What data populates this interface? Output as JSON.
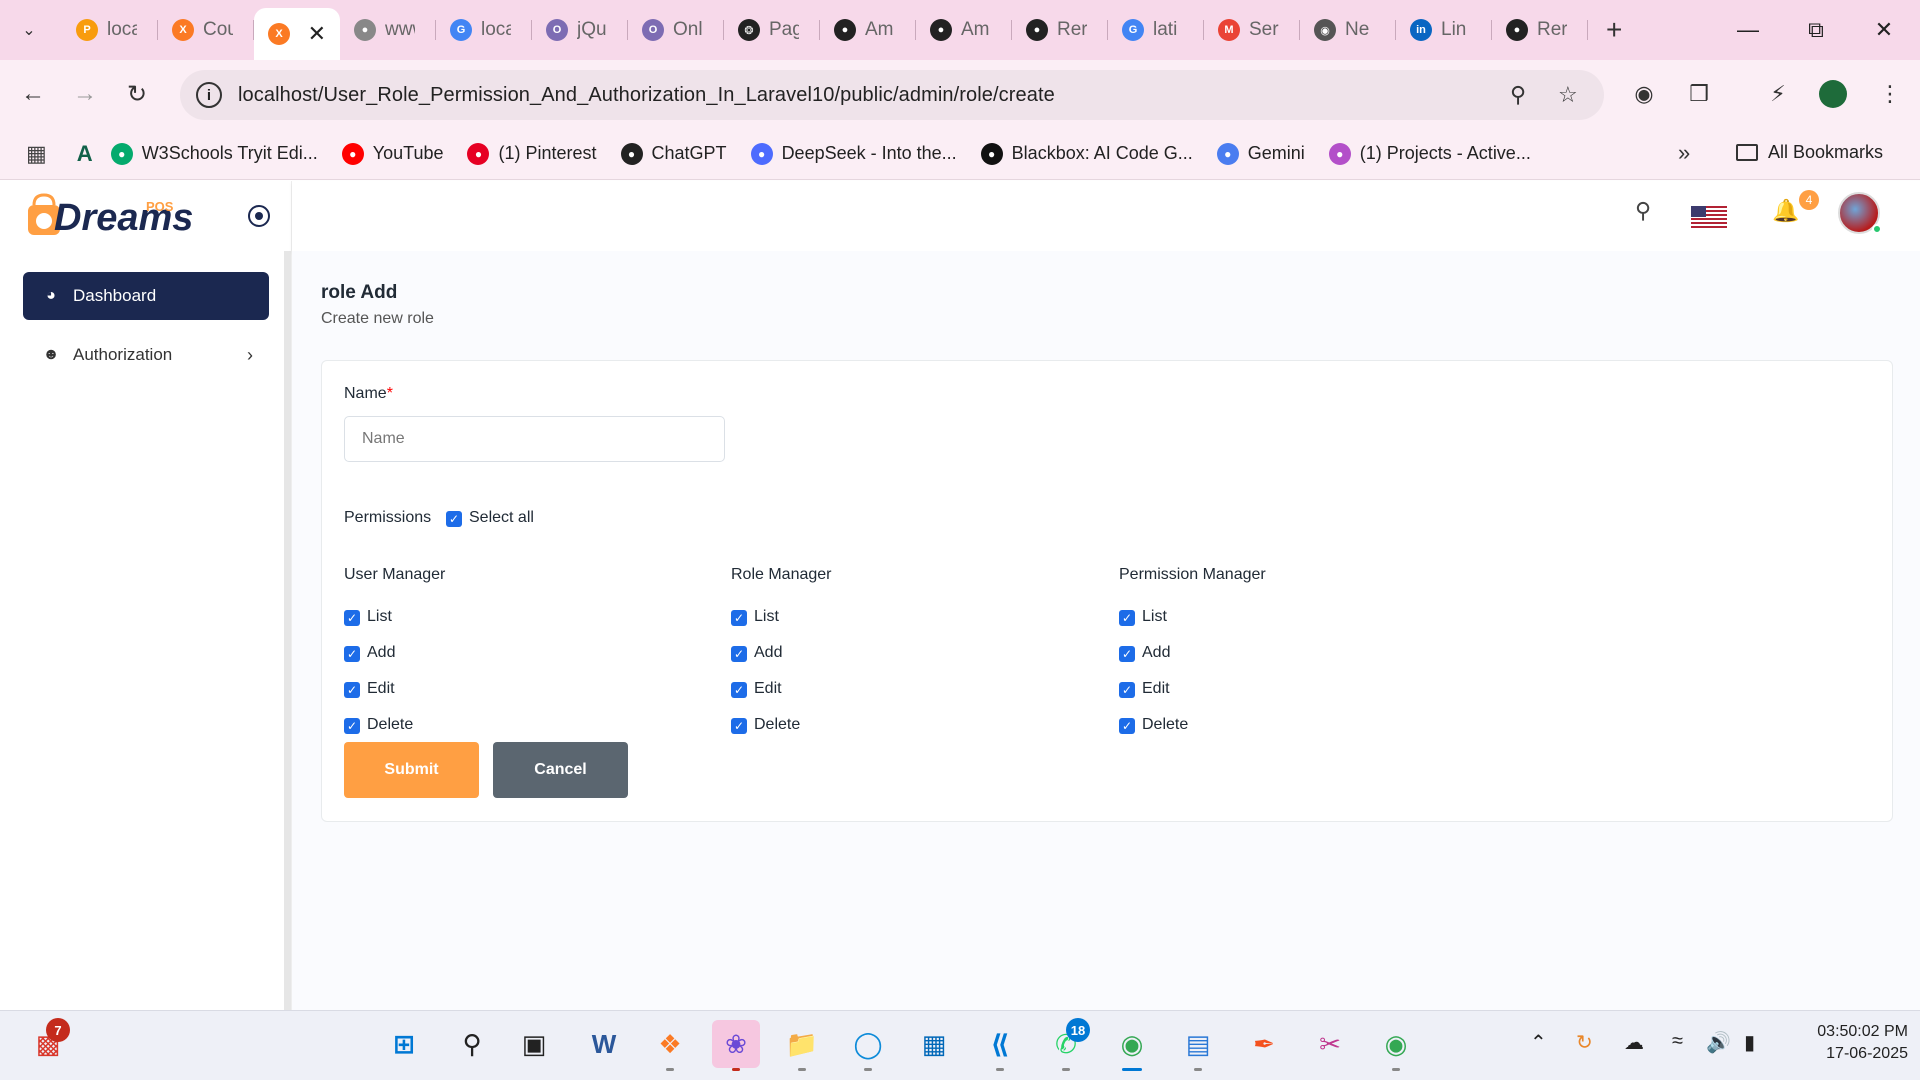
{
  "browser": {
    "tabs": [
      {
        "title": "loca",
        "icon": "phpmyadmin-icon",
        "color": "#f89c0e",
        "active": false
      },
      {
        "title": "Cou",
        "icon": "xampp-icon",
        "color": "#fb7a24",
        "active": false
      },
      {
        "title": "",
        "icon": "xampp-icon",
        "color": "#fb7a24",
        "active": true
      },
      {
        "title": "www",
        "icon": "globe-icon",
        "color": "#888888",
        "active": false
      },
      {
        "title": "loca",
        "icon": "google-icon",
        "color": "#4285f4",
        "active": false
      },
      {
        "title": "jQu",
        "icon": "owl-icon",
        "color": "#7d6cb3",
        "active": false
      },
      {
        "title": "Onl",
        "icon": "owl-icon",
        "color": "#7d6cb3",
        "active": false
      },
      {
        "title": "Pag",
        "icon": "chatgpt-icon",
        "color": "#222222",
        "active": false
      },
      {
        "title": "Am",
        "icon": "github-icon",
        "color": "#222222",
        "active": false
      },
      {
        "title": "Am",
        "icon": "github-icon",
        "color": "#222222",
        "active": false
      },
      {
        "title": "Rer",
        "icon": "github-icon",
        "color": "#222222",
        "active": false
      },
      {
        "title": "lati",
        "icon": "google-icon",
        "color": "#4285f4",
        "active": false
      },
      {
        "title": "Ser",
        "icon": "gmail-icon",
        "color": "#ea4335",
        "active": false
      },
      {
        "title": "Ne",
        "icon": "chrome-icon",
        "color": "#555555",
        "active": false
      },
      {
        "title": "Lin",
        "icon": "linkedin-icon",
        "color": "#0a66c2",
        "active": false
      },
      {
        "title": "Rer",
        "icon": "github-icon",
        "color": "#222222",
        "active": false
      }
    ],
    "url": "localhost/User_Role_Permission_And_Authorization_In_Laravel10/public/admin/role/create",
    "bookmarks": [
      {
        "label": "",
        "icon": "apps-grid-icon"
      },
      {
        "label": "",
        "icon": "a-logo-icon"
      },
      {
        "label": "W3Schools Tryit Edi...",
        "icon": "w3schools-icon",
        "color": "#04aa6d"
      },
      {
        "label": "YouTube",
        "icon": "youtube-icon",
        "color": "#ff0000"
      },
      {
        "label": "(1) Pinterest",
        "icon": "pinterest-icon",
        "color": "#e60023"
      },
      {
        "label": "ChatGPT",
        "icon": "chatgpt-icon",
        "color": "#222222"
      },
      {
        "label": "DeepSeek - Into the...",
        "icon": "deepseek-icon",
        "color": "#4d6bfe"
      },
      {
        "label": "Blackbox: AI Code G...",
        "icon": "blackbox-icon",
        "color": "#111111"
      },
      {
        "label": "Gemini",
        "icon": "gemini-icon",
        "color": "#4a7df0"
      },
      {
        "label": "(1) Projects - Active...",
        "icon": "projects-icon",
        "color": "#b34fc9"
      }
    ],
    "all_bookmarks": "All Bookmarks"
  },
  "app": {
    "logo_text": "Dreams",
    "logo_sup": "POS",
    "menu": [
      {
        "label": "Dashboard",
        "icon": "dashboard-icon",
        "active": true
      },
      {
        "label": "Authorization",
        "icon": "user-icon",
        "active": false
      }
    ],
    "notification_count": "4",
    "accent": "#ff9f43",
    "primary": "#1b2850"
  },
  "page": {
    "title": "role Add",
    "subtitle": "Create new role",
    "name_label": "Name",
    "name_required": "*",
    "name_placeholder": "Name",
    "name_value": "",
    "permissions_label": "Permissions",
    "select_all_label": "Select all",
    "select_all_checked": true,
    "groups": [
      {
        "title": "User Manager",
        "items": [
          {
            "label": "List",
            "checked": true
          },
          {
            "label": "Add",
            "checked": true
          },
          {
            "label": "Edit",
            "checked": true
          },
          {
            "label": "Delete",
            "checked": true
          }
        ]
      },
      {
        "title": "Role Manager",
        "items": [
          {
            "label": "List",
            "checked": true
          },
          {
            "label": "Add",
            "checked": true
          },
          {
            "label": "Edit",
            "checked": true
          },
          {
            "label": "Delete",
            "checked": true
          }
        ]
      },
      {
        "title": "Permission Manager",
        "items": [
          {
            "label": "List",
            "checked": true
          },
          {
            "label": "Add",
            "checked": true
          },
          {
            "label": "Edit",
            "checked": true
          },
          {
            "label": "Delete",
            "checked": true
          }
        ]
      }
    ],
    "submit_label": "Submit",
    "cancel_label": "Cancel",
    "submit_color": "#ff9f43",
    "cancel_color": "#5b6670"
  },
  "taskbar": {
    "left_badge": "7",
    "whatsapp_badge": "18",
    "time": "03:50:02 PM",
    "date": "17-06-2025"
  }
}
